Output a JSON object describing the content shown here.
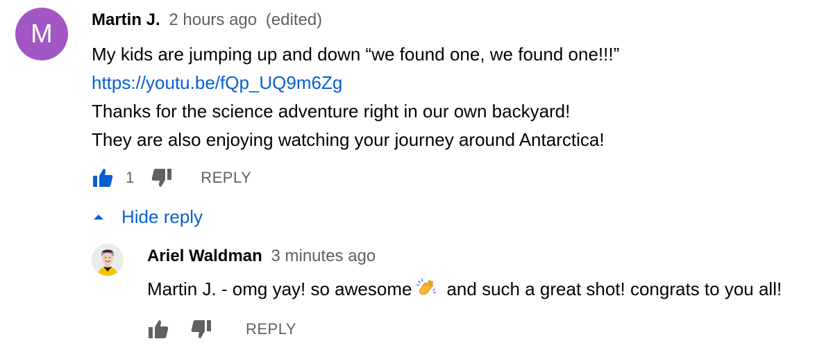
{
  "comment": {
    "avatar_letter": "M",
    "avatar_color": "#a257c4",
    "author": "Martin J.",
    "time": "2 hours ago",
    "edited": "(edited)",
    "lines": [
      "My kids are jumping up and down “we found one, we found one!!!”",
      "https://youtu.be/fQp_UQ9m6Zg",
      "Thanks for the science adventure right in our own backyard!",
      "They are also enjoying watching your journey around Antarctica!"
    ],
    "like_count": "1",
    "reply_label": "REPLY",
    "like_icon": "thumbs-up-filled-icon",
    "dislike_icon": "thumbs-down-icon"
  },
  "hide_reply": {
    "label": "Hide reply",
    "icon": "caret-up-icon"
  },
  "reply": {
    "author": "Ariel Waldman",
    "time": "3 minutes ago",
    "text_before_emoji": "Martin J. - omg yay! so awesome",
    "emoji": "clapping-hands-icon",
    "text_after_emoji": "and such a great shot! congrats to you all!",
    "reply_label": "REPLY",
    "like_icon": "thumbs-up-icon",
    "dislike_icon": "thumbs-down-icon"
  },
  "colors": {
    "link": "#065fd4",
    "like_active": "#065fd4",
    "muted": "#606060"
  }
}
